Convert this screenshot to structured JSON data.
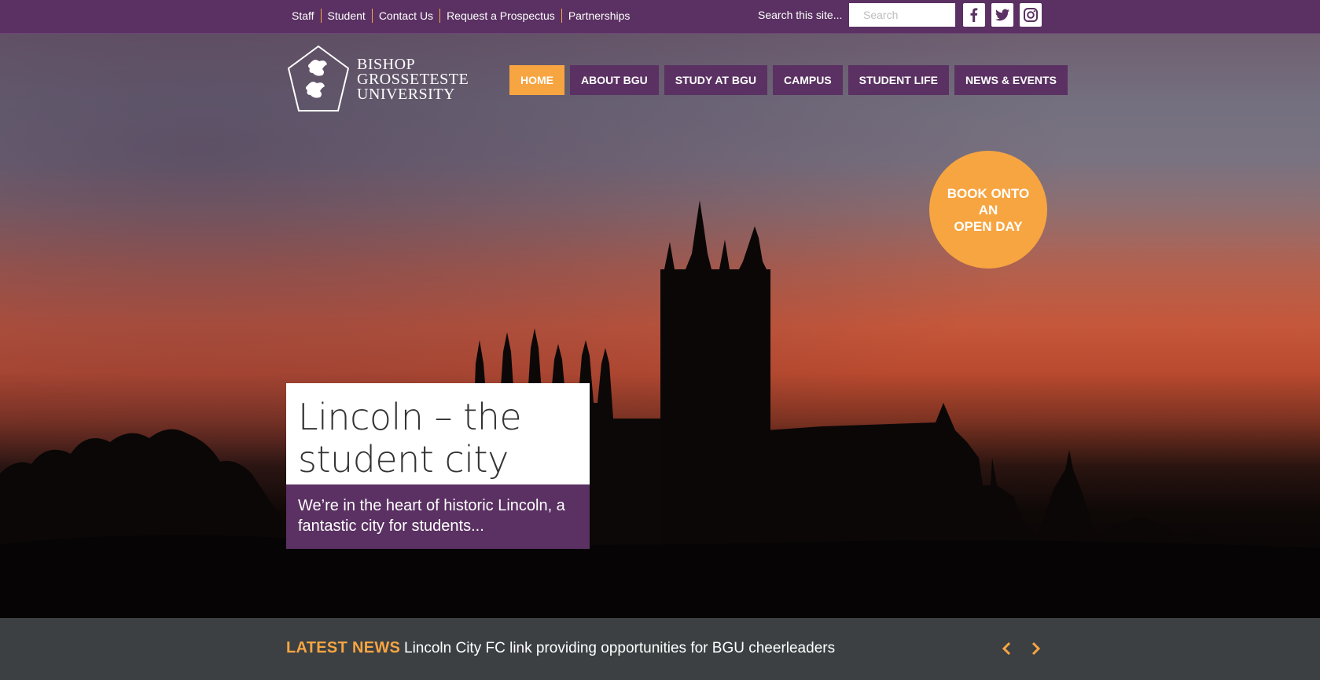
{
  "topbar": {
    "links": [
      "Staff",
      "Student",
      "Contact Us",
      "Request a Prospectus",
      "Partnerships"
    ],
    "search_label": "Search this site...",
    "search_placeholder": "Search",
    "social": [
      "facebook-icon",
      "twitter-icon",
      "instagram-icon"
    ]
  },
  "logo": {
    "line1": "BISHOP",
    "line2": "GROSSETESTE",
    "line3": "UNIVERSITY"
  },
  "nav": {
    "items": [
      "HOME",
      "ABOUT BGU",
      "STUDY AT BGU",
      "CAMPUS",
      "STUDENT LIFE",
      "NEWS & EVENTS"
    ],
    "active": "HOME"
  },
  "open_day": {
    "line1": "BOOK ONTO",
    "line2": "AN",
    "line3": "OPEN DAY"
  },
  "hero": {
    "title": "Lincoln – the student city",
    "text": "We’re in the heart of historic Lincoln, a fantastic city for students..."
  },
  "latest_news": {
    "label": "LATEST NEWS",
    "headline": "Lincoln City FC link providing opportunities for BGU cheerleaders"
  },
  "colors": {
    "brand_purple": "#5a3162",
    "accent_orange": "#f7a541",
    "news_bar": "#3c4043"
  }
}
